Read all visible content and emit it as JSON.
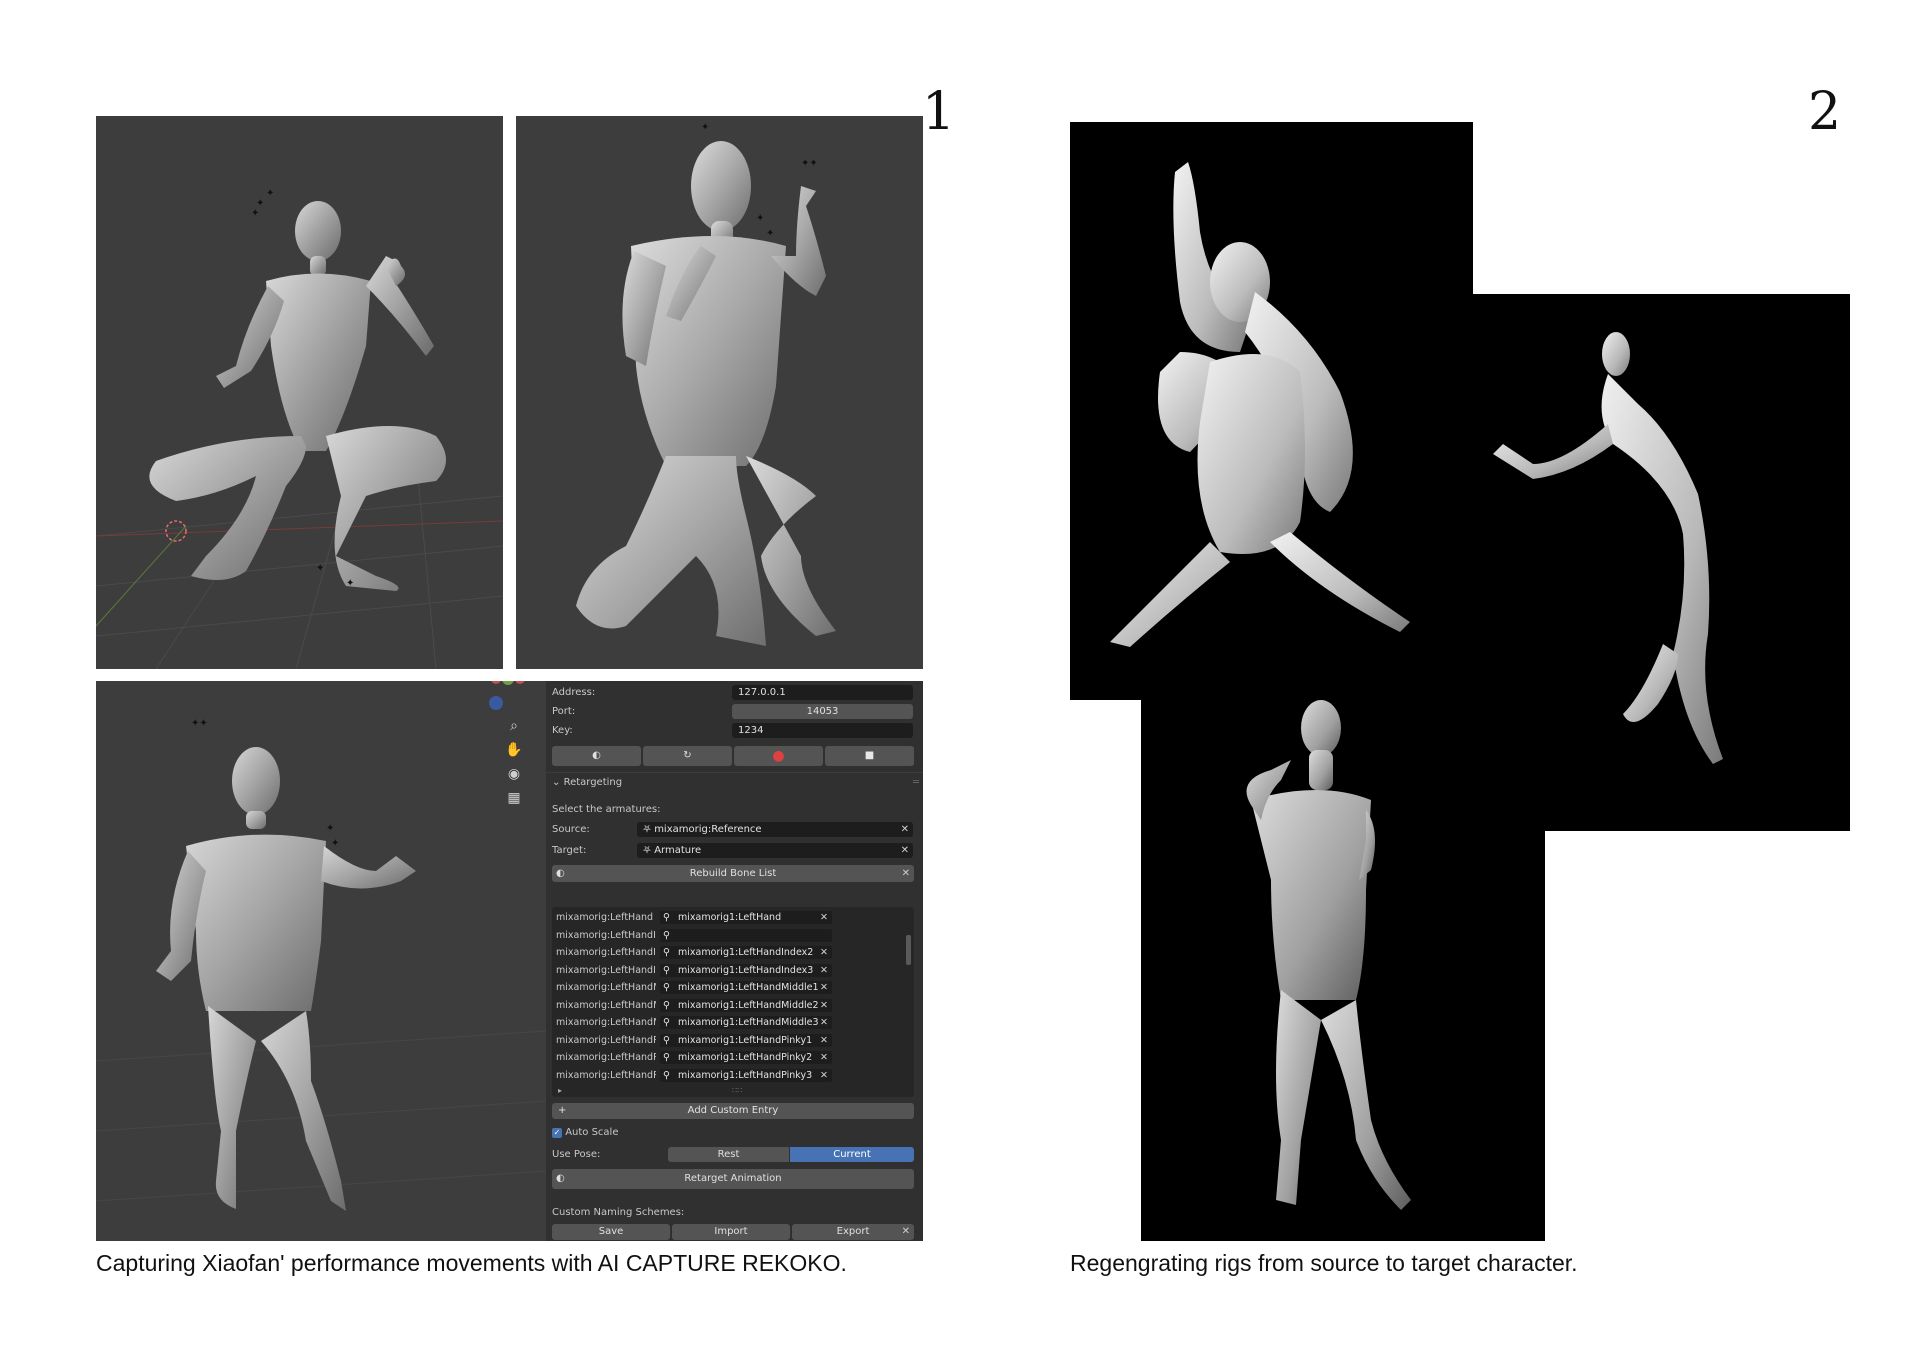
{
  "page_numbers": {
    "left": "1",
    "right": "2"
  },
  "captions": {
    "left": "Capturing Xiaofan' performance movements with AI CAPTURE REKOKO.",
    "right": "Regengrating rigs from source to target character."
  },
  "blender_panel": {
    "address_label": "Address:",
    "address_value": "127.0.0.1",
    "port_label": "Port:",
    "port_value": "14053",
    "key_label": "Key:",
    "key_value": "1234",
    "transport_icons": [
      "connect-icon",
      "refresh-icon",
      "record-icon",
      "stop-icon"
    ],
    "retargeting_header": "Retargeting",
    "select_label": "Select the armatures:",
    "source_label": "Source:",
    "source_value": "mixamorig:Reference",
    "target_label": "Target:",
    "target_value": "Armature",
    "rebuild_label": "Rebuild Bone List",
    "bone_rows": [
      {
        "source": "mixamorig:LeftHand",
        "target": "mixamorig1:LeftHand"
      },
      {
        "source": "mixamorig:LeftHandInd...",
        "target": ""
      },
      {
        "source": "mixamorig:LeftHandInd...",
        "target": "mixamorig1:LeftHandIndex2"
      },
      {
        "source": "mixamorig:LeftHandInd...",
        "target": "mixamorig1:LeftHandIndex3"
      },
      {
        "source": "mixamorig:LeftHandMid...",
        "target": "mixamorig1:LeftHandMiddle1"
      },
      {
        "source": "mixamorig:LeftHandMid...",
        "target": "mixamorig1:LeftHandMiddle2"
      },
      {
        "source": "mixamorig:LeftHandMid...",
        "target": "mixamorig1:LeftHandMiddle3"
      },
      {
        "source": "mixamorig:LeftHandPink",
        "target": "mixamorig1:LeftHandPinky1"
      },
      {
        "source": "mixamorig:LeftHandPink",
        "target": "mixamorig1:LeftHandPinky2"
      },
      {
        "source": "mixamorig:LeftHandPink",
        "target": "mixamorig1:LeftHandPinky3"
      }
    ],
    "add_custom_entry": "Add Custom Entry",
    "auto_scale_label": "Auto Scale",
    "use_pose_label": "Use Pose:",
    "pose_rest": "Rest",
    "pose_current": "Current",
    "retarget_animation": "Retarget Animation",
    "custom_naming_label": "Custom Naming Schemes:",
    "save_label": "Save",
    "import_label": "Import",
    "export_label": "Export"
  },
  "colors": {
    "viewport_bg": "#3d3d3d",
    "panel_bg": "#303030",
    "accent_blue": "#4772b3",
    "record_red": "#e04040",
    "render_bg": "#000000"
  }
}
